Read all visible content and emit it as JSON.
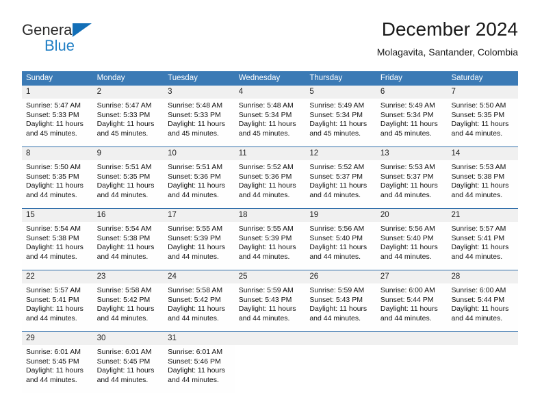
{
  "logo": {
    "text_top": "General",
    "text_bottom": "Blue",
    "triangle_color": "#136fb7",
    "blue_color": "#1f7ec4"
  },
  "header": {
    "title": "December 2024",
    "subtitle": "Molagavita, Santander, Colombia"
  },
  "theme": {
    "header_blue": "#3b7ab5",
    "separator_blue": "#2d6ca8",
    "daynum_band": "#f0f0f0"
  },
  "weekdays": [
    "Sunday",
    "Monday",
    "Tuesday",
    "Wednesday",
    "Thursday",
    "Friday",
    "Saturday"
  ],
  "weeks": [
    [
      {
        "day": "1",
        "sunrise": "Sunrise: 5:47 AM",
        "sunset": "Sunset: 5:33 PM",
        "daylight1": "Daylight: 11 hours",
        "daylight2": "and 45 minutes."
      },
      {
        "day": "2",
        "sunrise": "Sunrise: 5:47 AM",
        "sunset": "Sunset: 5:33 PM",
        "daylight1": "Daylight: 11 hours",
        "daylight2": "and 45 minutes."
      },
      {
        "day": "3",
        "sunrise": "Sunrise: 5:48 AM",
        "sunset": "Sunset: 5:33 PM",
        "daylight1": "Daylight: 11 hours",
        "daylight2": "and 45 minutes."
      },
      {
        "day": "4",
        "sunrise": "Sunrise: 5:48 AM",
        "sunset": "Sunset: 5:34 PM",
        "daylight1": "Daylight: 11 hours",
        "daylight2": "and 45 minutes."
      },
      {
        "day": "5",
        "sunrise": "Sunrise: 5:49 AM",
        "sunset": "Sunset: 5:34 PM",
        "daylight1": "Daylight: 11 hours",
        "daylight2": "and 45 minutes."
      },
      {
        "day": "6",
        "sunrise": "Sunrise: 5:49 AM",
        "sunset": "Sunset: 5:34 PM",
        "daylight1": "Daylight: 11 hours",
        "daylight2": "and 45 minutes."
      },
      {
        "day": "7",
        "sunrise": "Sunrise: 5:50 AM",
        "sunset": "Sunset: 5:35 PM",
        "daylight1": "Daylight: 11 hours",
        "daylight2": "and 44 minutes."
      }
    ],
    [
      {
        "day": "8",
        "sunrise": "Sunrise: 5:50 AM",
        "sunset": "Sunset: 5:35 PM",
        "daylight1": "Daylight: 11 hours",
        "daylight2": "and 44 minutes."
      },
      {
        "day": "9",
        "sunrise": "Sunrise: 5:51 AM",
        "sunset": "Sunset: 5:35 PM",
        "daylight1": "Daylight: 11 hours",
        "daylight2": "and 44 minutes."
      },
      {
        "day": "10",
        "sunrise": "Sunrise: 5:51 AM",
        "sunset": "Sunset: 5:36 PM",
        "daylight1": "Daylight: 11 hours",
        "daylight2": "and 44 minutes."
      },
      {
        "day": "11",
        "sunrise": "Sunrise: 5:52 AM",
        "sunset": "Sunset: 5:36 PM",
        "daylight1": "Daylight: 11 hours",
        "daylight2": "and 44 minutes."
      },
      {
        "day": "12",
        "sunrise": "Sunrise: 5:52 AM",
        "sunset": "Sunset: 5:37 PM",
        "daylight1": "Daylight: 11 hours",
        "daylight2": "and 44 minutes."
      },
      {
        "day": "13",
        "sunrise": "Sunrise: 5:53 AM",
        "sunset": "Sunset: 5:37 PM",
        "daylight1": "Daylight: 11 hours",
        "daylight2": "and 44 minutes."
      },
      {
        "day": "14",
        "sunrise": "Sunrise: 5:53 AM",
        "sunset": "Sunset: 5:38 PM",
        "daylight1": "Daylight: 11 hours",
        "daylight2": "and 44 minutes."
      }
    ],
    [
      {
        "day": "15",
        "sunrise": "Sunrise: 5:54 AM",
        "sunset": "Sunset: 5:38 PM",
        "daylight1": "Daylight: 11 hours",
        "daylight2": "and 44 minutes."
      },
      {
        "day": "16",
        "sunrise": "Sunrise: 5:54 AM",
        "sunset": "Sunset: 5:38 PM",
        "daylight1": "Daylight: 11 hours",
        "daylight2": "and 44 minutes."
      },
      {
        "day": "17",
        "sunrise": "Sunrise: 5:55 AM",
        "sunset": "Sunset: 5:39 PM",
        "daylight1": "Daylight: 11 hours",
        "daylight2": "and 44 minutes."
      },
      {
        "day": "18",
        "sunrise": "Sunrise: 5:55 AM",
        "sunset": "Sunset: 5:39 PM",
        "daylight1": "Daylight: 11 hours",
        "daylight2": "and 44 minutes."
      },
      {
        "day": "19",
        "sunrise": "Sunrise: 5:56 AM",
        "sunset": "Sunset: 5:40 PM",
        "daylight1": "Daylight: 11 hours",
        "daylight2": "and 44 minutes."
      },
      {
        "day": "20",
        "sunrise": "Sunrise: 5:56 AM",
        "sunset": "Sunset: 5:40 PM",
        "daylight1": "Daylight: 11 hours",
        "daylight2": "and 44 minutes."
      },
      {
        "day": "21",
        "sunrise": "Sunrise: 5:57 AM",
        "sunset": "Sunset: 5:41 PM",
        "daylight1": "Daylight: 11 hours",
        "daylight2": "and 44 minutes."
      }
    ],
    [
      {
        "day": "22",
        "sunrise": "Sunrise: 5:57 AM",
        "sunset": "Sunset: 5:41 PM",
        "daylight1": "Daylight: 11 hours",
        "daylight2": "and 44 minutes."
      },
      {
        "day": "23",
        "sunrise": "Sunrise: 5:58 AM",
        "sunset": "Sunset: 5:42 PM",
        "daylight1": "Daylight: 11 hours",
        "daylight2": "and 44 minutes."
      },
      {
        "day": "24",
        "sunrise": "Sunrise: 5:58 AM",
        "sunset": "Sunset: 5:42 PM",
        "daylight1": "Daylight: 11 hours",
        "daylight2": "and 44 minutes."
      },
      {
        "day": "25",
        "sunrise": "Sunrise: 5:59 AM",
        "sunset": "Sunset: 5:43 PM",
        "daylight1": "Daylight: 11 hours",
        "daylight2": "and 44 minutes."
      },
      {
        "day": "26",
        "sunrise": "Sunrise: 5:59 AM",
        "sunset": "Sunset: 5:43 PM",
        "daylight1": "Daylight: 11 hours",
        "daylight2": "and 44 minutes."
      },
      {
        "day": "27",
        "sunrise": "Sunrise: 6:00 AM",
        "sunset": "Sunset: 5:44 PM",
        "daylight1": "Daylight: 11 hours",
        "daylight2": "and 44 minutes."
      },
      {
        "day": "28",
        "sunrise": "Sunrise: 6:00 AM",
        "sunset": "Sunset: 5:44 PM",
        "daylight1": "Daylight: 11 hours",
        "daylight2": "and 44 minutes."
      }
    ],
    [
      {
        "day": "29",
        "sunrise": "Sunrise: 6:01 AM",
        "sunset": "Sunset: 5:45 PM",
        "daylight1": "Daylight: 11 hours",
        "daylight2": "and 44 minutes."
      },
      {
        "day": "30",
        "sunrise": "Sunrise: 6:01 AM",
        "sunset": "Sunset: 5:45 PM",
        "daylight1": "Daylight: 11 hours",
        "daylight2": "and 44 minutes."
      },
      {
        "day": "31",
        "sunrise": "Sunrise: 6:01 AM",
        "sunset": "Sunset: 5:46 PM",
        "daylight1": "Daylight: 11 hours",
        "daylight2": "and 44 minutes."
      },
      {
        "day": "",
        "sunrise": "",
        "sunset": "",
        "daylight1": "",
        "daylight2": ""
      },
      {
        "day": "",
        "sunrise": "",
        "sunset": "",
        "daylight1": "",
        "daylight2": ""
      },
      {
        "day": "",
        "sunrise": "",
        "sunset": "",
        "daylight1": "",
        "daylight2": ""
      },
      {
        "day": "",
        "sunrise": "",
        "sunset": "",
        "daylight1": "",
        "daylight2": ""
      }
    ]
  ]
}
